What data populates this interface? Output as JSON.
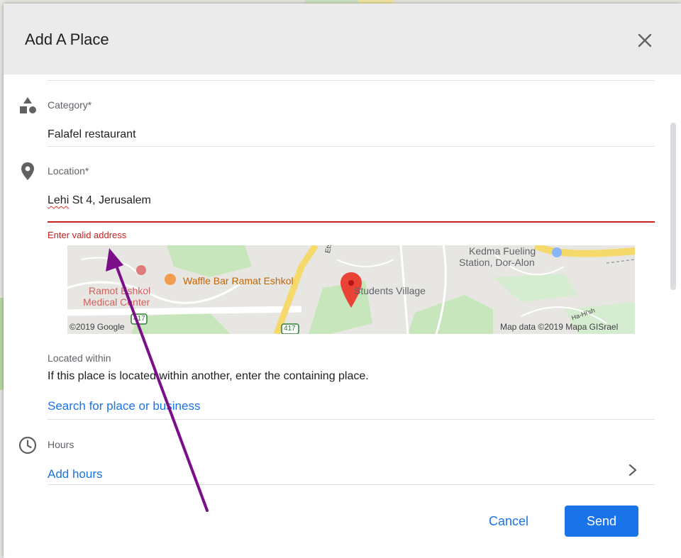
{
  "dialog": {
    "title": "Add A Place",
    "close_icon": "close-icon"
  },
  "category": {
    "label": "Category*",
    "value": "Falafel restaurant",
    "icon": "shapes-icon"
  },
  "location": {
    "label": "Location*",
    "value_misspelled": "Lehi",
    "value_rest": " St 4, Jerusalem",
    "error": "Enter valid address",
    "error_color": "#c5221f",
    "icon": "place-pin-icon"
  },
  "map": {
    "labels": {
      "kedma": "Kedma Fueling",
      "station": "Station, Dor-Alon",
      "waffle": "Waffle Bar Ramat Eshkol",
      "ramot": "Ramot Eshkol",
      "medical": "Medical Center",
      "students": "Students Village",
      "etsel": "Etsel St",
      "route_417a": "417",
      "route_417b": "417",
      "hahish": "Ha-Hi'sh",
      "copyright": "©2019 Google",
      "attribution": "Map data ©2019 Mapa GISrael"
    }
  },
  "located_within": {
    "label": "Located within",
    "description": "If this place is located within another, enter the containing place.",
    "search_link": "Search for place or business"
  },
  "hours": {
    "label": "Hours",
    "add_link": "Add hours",
    "icon": "clock-icon"
  },
  "actions": {
    "cancel": "Cancel",
    "send": "Send"
  },
  "colors": {
    "accent": "#1a73e8",
    "annotation_arrow": "#7b0f8a"
  }
}
